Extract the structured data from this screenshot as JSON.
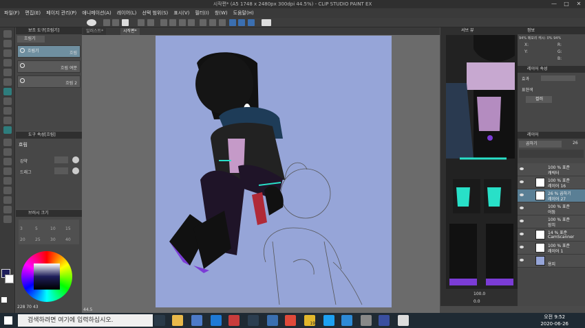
{
  "titlebar": {
    "title": "시작편* (A5 1748 x 2480px 300dpi 44.5%) - CLIP STUDIO PAINT EX",
    "min": "—",
    "max": "□",
    "close": "✕"
  },
  "menu": [
    "파일(F)",
    "편집(E)",
    "페이지 관리(P)",
    "애니메이션(A)",
    "레이어(L)",
    "선택 범위(S)",
    "표시(V)",
    "필터(I)",
    "창(W)",
    "도움말(H)"
  ],
  "subtool": {
    "title": "보조 도구[흐림기]",
    "tab": "흐림기",
    "items": [
      {
        "label": "흐림기",
        "sub": "흐림"
      },
      {
        "label": "",
        "sub": "흐림 여분"
      },
      {
        "label": "",
        "sub": "흐림 2"
      }
    ]
  },
  "toolprop": {
    "title": "도구 속성[흐림]",
    "name": "흐림",
    "row1": "강약",
    "row2": "드래그"
  },
  "brushsize": {
    "title": "브러시 크기",
    "sizes": [
      "3",
      "5",
      "10",
      "15",
      "20",
      "25",
      "30",
      "40"
    ]
  },
  "color": {
    "main": "#1e1e5a",
    "sub": "#ffffff",
    "readout": "228  70  43"
  },
  "tabs": [
    "일러스트*",
    "시작편*"
  ],
  "zoom": "44.5",
  "navigator": {
    "title": "내비게이터",
    "label": "서브 뷰"
  },
  "info": {
    "title": "정보",
    "row": "94% 메모리 캐시: 0%  94%",
    "x": "X:",
    "y": "Y:",
    "r": "R:",
    "g": "G:",
    "b": "B:"
  },
  "layerprop": {
    "title": "레이어 속성",
    "effect": "효과",
    "expr": "표현색",
    "mode": "컬러"
  },
  "layers": {
    "title": "레이어",
    "blend": "곱하기",
    "opacity": "26",
    "items": [
      {
        "pct": "100 % 표준",
        "name": "캐릭터"
      },
      {
        "pct": "100 % 표준",
        "name": "레이어 16"
      },
      {
        "pct": "26 % 곱하기",
        "name": "레이어 27"
      },
      {
        "pct": "100 % 표준",
        "name": "어둠"
      },
      {
        "pct": "100 % 표준",
        "name": "장치"
      },
      {
        "pct": "14 % 표준",
        "name": "CamScanner"
      },
      {
        "pct": "100 % 표준",
        "name": "레이어 1"
      },
      {
        "pct": "",
        "name": "용지"
      }
    ]
  },
  "navbottom": {
    "zoom": "100.0",
    "rot": "0.0"
  },
  "taskbar": {
    "search_placeholder": "검색하려면 여기에 입력하십시오.",
    "time": "오전 9:52",
    "date": "2020-06-26",
    "badge": "19"
  }
}
